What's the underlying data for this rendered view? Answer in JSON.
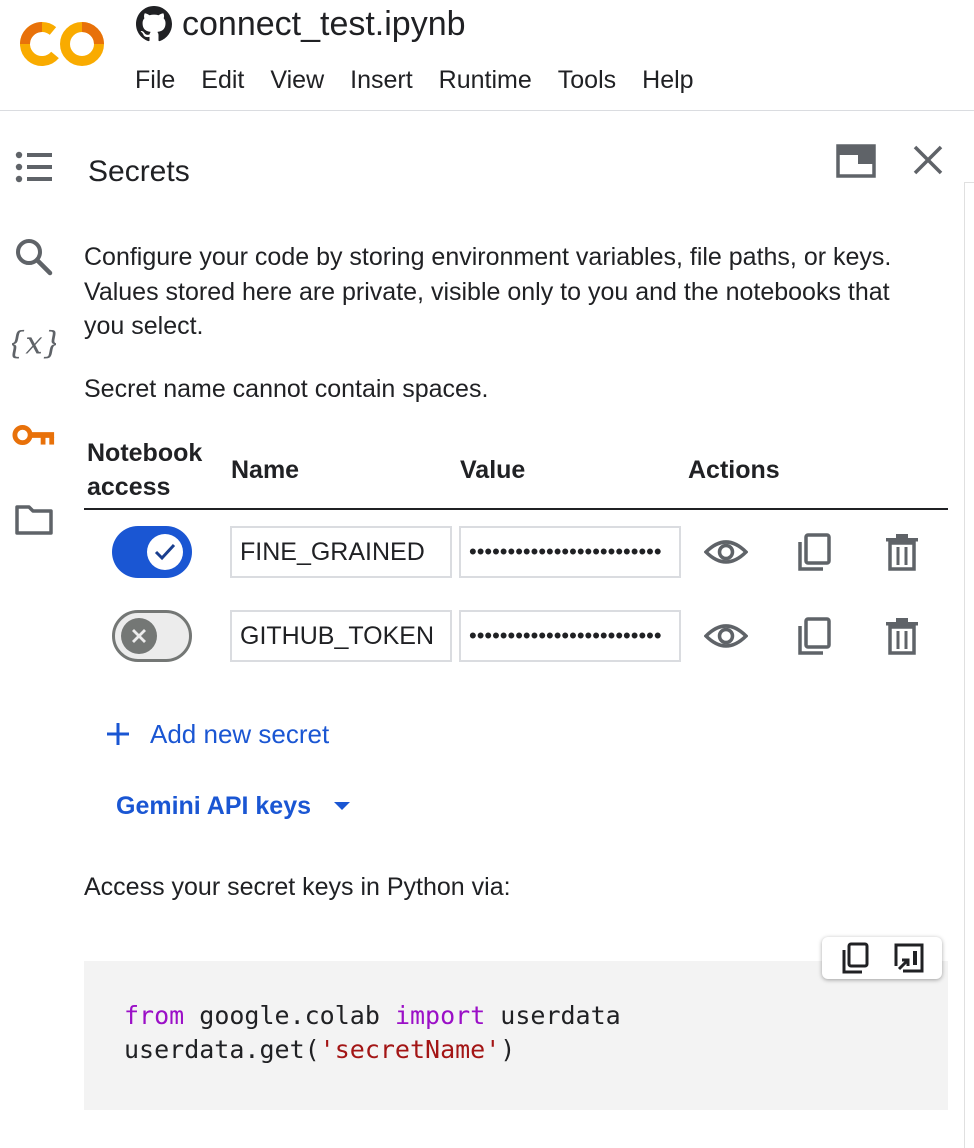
{
  "app": {
    "logo_text": "CO",
    "doc_title": "connect_test.ipynb",
    "icons": {
      "logo": "colab-logo",
      "repo": "github-icon"
    }
  },
  "menu": [
    "File",
    "Edit",
    "View",
    "Insert",
    "Runtime",
    "Tools",
    "Help"
  ],
  "rail": {
    "icons": [
      "toc-icon",
      "search-icon",
      "variables-icon",
      "key-icon",
      "folder-icon"
    ],
    "active": "key-icon",
    "active_color": "#e8710a"
  },
  "panel": {
    "title": "Secrets",
    "description": "Configure your code by storing environment variables, file paths, or keys. Values stored here are private, visible only to you and the notebooks that you select.",
    "note": "Secret name cannot contain spaces.",
    "columns": {
      "access": "Notebook access",
      "name": "Name",
      "value": "Value",
      "actions": "Actions"
    },
    "secrets": [
      {
        "name": "FINE_GRAINED",
        "value": "•••••••••••••••••••••••••",
        "access": true
      },
      {
        "name": "GITHUB_TOKEN",
        "value": "•••••••••••••••••••••••••",
        "access": false
      }
    ],
    "add_label": "Add new secret",
    "gemini_label": "Gemini API keys",
    "access_text": "Access your secret keys in Python via:"
  },
  "code": {
    "line1": {
      "kw1": "from",
      "mod": " google.colab ",
      "kw2": "import",
      "name": " userdata"
    },
    "line2": {
      "pre": "userdata.get(",
      "str": "'secretName'",
      "post": ")"
    }
  },
  "colors": {
    "accent": "#1a56d3",
    "keyword": "#9b0fc7",
    "string": "#a31515",
    "logo_orange": "#f9ab00",
    "logo_dark_orange": "#e8710a"
  }
}
